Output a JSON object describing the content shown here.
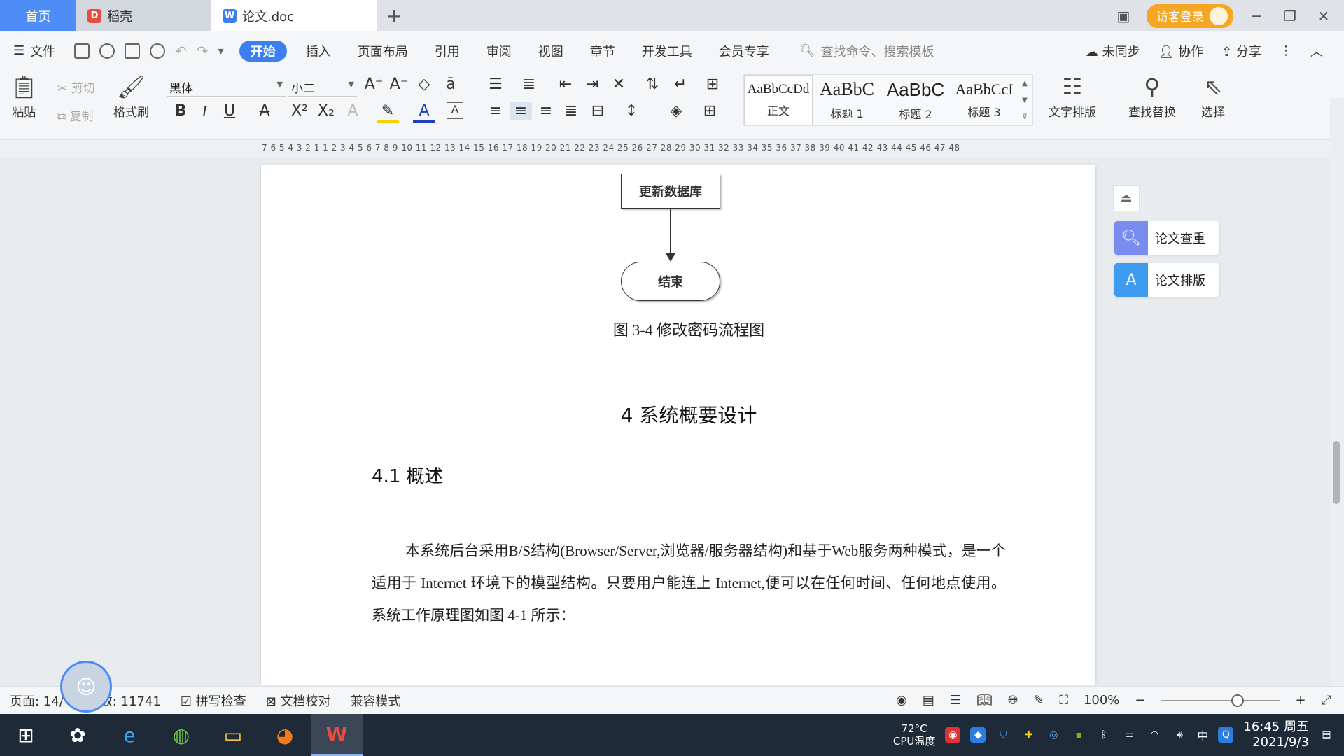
{
  "tabs": {
    "home": "首页",
    "daoke": "稻壳",
    "document": "论文.doc",
    "add": "+"
  },
  "titlebar": {
    "visitor_login": "访客登录"
  },
  "menu": {
    "file": "文件",
    "items": [
      "开始",
      "插入",
      "页面布局",
      "引用",
      "审阅",
      "视图",
      "章节",
      "开发工具",
      "会员专享"
    ],
    "search_placeholder": "查找命令、搜索模板",
    "sync": "未同步",
    "collaborate": "协作",
    "share": "分享"
  },
  "ribbon": {
    "paste": "粘贴",
    "cut": "剪切",
    "copy": "复制",
    "format_painter": "格式刷",
    "font_name": "黑体",
    "font_size": "小二",
    "styles": [
      {
        "sample": "AaBbCcDd",
        "name": "正文"
      },
      {
        "sample": "AaBbC",
        "name": "标题 1"
      },
      {
        "sample": "AaBbC",
        "name": "标题 2"
      },
      {
        "sample": "AaBbCcI",
        "name": "标题 3"
      }
    ],
    "text_layout": "文字排版",
    "find_replace": "查找替换",
    "select": "选择"
  },
  "ruler": {
    "numbers": "7  6  5  4  3  2  1     1  2  3  4  5  6  7  8  9 10 11 12 13 14 15 16 17 18 19 20 21 22 23 24 25 26 27 28 29 30 31 32 33 34 35 36 37 38 39 40 41 42 43 44 45 46 47 48"
  },
  "document": {
    "flow_update_db": "更新数据库",
    "flow_end": "结束",
    "figure_caption": "图 3-4 修改密码流程图",
    "heading1": "4 系统概要设计",
    "heading2": "4.1 概述",
    "paragraph": "本系统后台采用B/S结构(Browser/Server,浏览器/服务器结构)和基于Web服务两种模式，是一个适用于 Internet 环境下的模型结构。只要用户能连上 Internet,便可以在任何时间、任何地点使用。系统工作原理图如图 4-1 所示："
  },
  "side_panel": {
    "check": "论文查重",
    "layout": "论文排版"
  },
  "status": {
    "page": "页面: 14/",
    "word_count": "数: 11741",
    "spell_check": "拼写检查",
    "doc_proof": "文档校对",
    "compat_mode": "兼容模式",
    "zoom": "100%"
  },
  "taskbar": {
    "cpu_temp": "72°C",
    "cpu_label": "CPU温度",
    "ime": "中",
    "time": "16:45 周五",
    "date": "2021/9/3"
  },
  "colors": {
    "accent": "#3d7ff0",
    "visitor": "#f5a623",
    "taskbar": "#1f2a38"
  }
}
